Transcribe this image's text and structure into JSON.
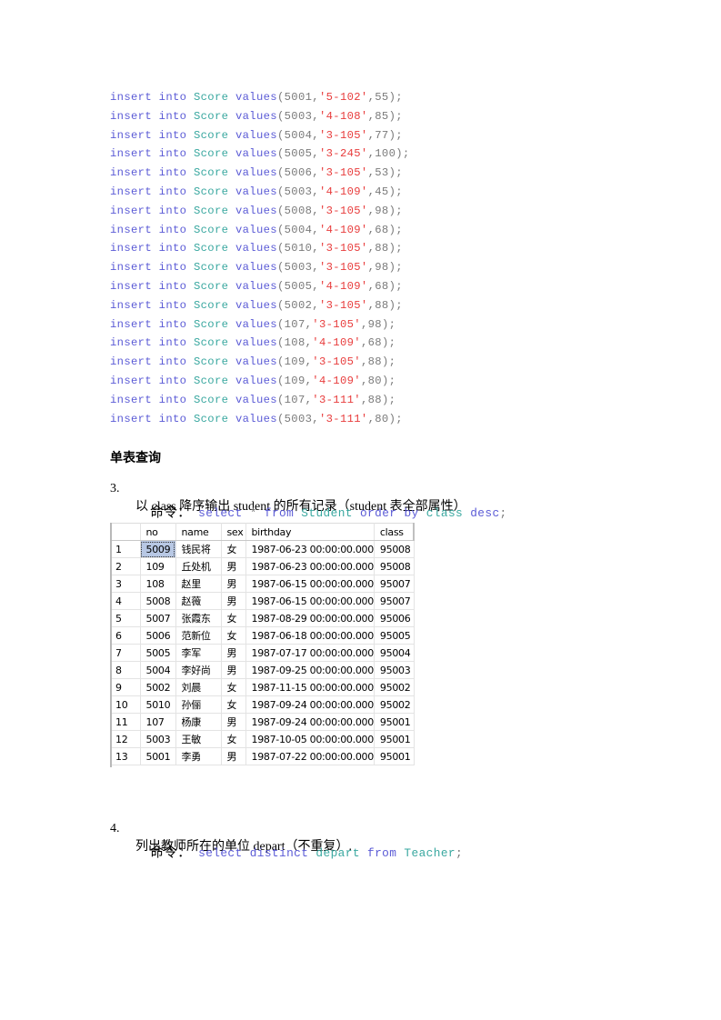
{
  "code_lines": [
    {
      "kw1": "insert",
      "kw2": "into",
      "table": "Score",
      "kw3": "values",
      "id": "5001",
      "course": "'5-102'",
      "score": "55"
    },
    {
      "kw1": "insert",
      "kw2": "into",
      "table": "Score",
      "kw3": "values",
      "id": "5003",
      "course": "'4-108'",
      "score": "85"
    },
    {
      "kw1": "insert",
      "kw2": "into",
      "table": "Score",
      "kw3": "values",
      "id": "5004",
      "course": "'3-105'",
      "score": "77"
    },
    {
      "kw1": "insert",
      "kw2": "into",
      "table": "Score",
      "kw3": "values",
      "id": "5005",
      "course": "'3-245'",
      "score": "100"
    },
    {
      "kw1": "insert",
      "kw2": "into",
      "table": "Score",
      "kw3": "values",
      "id": "5006",
      "course": "'3-105'",
      "score": "53"
    },
    {
      "kw1": "insert",
      "kw2": "into",
      "table": "Score",
      "kw3": "values",
      "id": "5003",
      "course": "'4-109'",
      "score": "45"
    },
    {
      "kw1": "insert",
      "kw2": "into",
      "table": "Score",
      "kw3": "values",
      "id": "5008",
      "course": "'3-105'",
      "score": "98"
    },
    {
      "kw1": "insert",
      "kw2": "into",
      "table": "Score",
      "kw3": "values",
      "id": "5004",
      "course": "'4-109'",
      "score": "68"
    },
    {
      "kw1": "insert",
      "kw2": "into",
      "table": "Score",
      "kw3": "values",
      "id": "5010",
      "course": "'3-105'",
      "score": "88"
    },
    {
      "kw1": "insert",
      "kw2": "into",
      "table": "Score",
      "kw3": "values",
      "id": "5003",
      "course": "'3-105'",
      "score": "98"
    },
    {
      "kw1": "insert",
      "kw2": "into",
      "table": "Score",
      "kw3": "values",
      "id": "5005",
      "course": "'4-109'",
      "score": "68"
    },
    {
      "kw1": "insert",
      "kw2": "into",
      "table": "Score",
      "kw3": "values",
      "id": "5002",
      "course": "'3-105'",
      "score": "88"
    },
    {
      "kw1": "insert",
      "kw2": "into",
      "table": "Score",
      "kw3": "values",
      "id": "107",
      "course": "'3-105'",
      "score": "98"
    },
    {
      "kw1": "insert",
      "kw2": "into",
      "table": "Score",
      "kw3": "values",
      "id": "108",
      "course": "'4-109'",
      "score": "68"
    },
    {
      "kw1": "insert",
      "kw2": "into",
      "table": "Score",
      "kw3": "values",
      "id": "109",
      "course": "'3-105'",
      "score": "88"
    },
    {
      "kw1": "insert",
      "kw2": "into",
      "table": "Score",
      "kw3": "values",
      "id": "109",
      "course": "'4-109'",
      "score": "80"
    },
    {
      "kw1": "insert",
      "kw2": "into",
      "table": "Score",
      "kw3": "values",
      "id": "107",
      "course": "'3-111'",
      "score": "88"
    },
    {
      "kw1": "insert",
      "kw2": "into",
      "table": "Score",
      "kw3": "values",
      "id": "5003",
      "course": "'3-111'",
      "score": "80"
    }
  ],
  "section_title": "单表查询",
  "questions": [
    {
      "num": "3.",
      "text": "以 class 降序输出 student 的所有记录（student 表全部属性）",
      "cmd_label": "命令：",
      "cmd": [
        {
          "t": "select",
          "c": "kw"
        },
        {
          "t": " ",
          "c": "pl"
        },
        {
          "t": "*",
          "c": "pl"
        },
        {
          "t": " ",
          "c": "pl"
        },
        {
          "t": "from",
          "c": "kw"
        },
        {
          "t": " ",
          "c": "pl"
        },
        {
          "t": "Student",
          "c": "tbl"
        },
        {
          "t": " ",
          "c": "pl"
        },
        {
          "t": "order",
          "c": "kw"
        },
        {
          "t": " ",
          "c": "pl"
        },
        {
          "t": "by",
          "c": "kw"
        },
        {
          "t": " ",
          "c": "pl"
        },
        {
          "t": "class",
          "c": "tbl"
        },
        {
          "t": " ",
          "c": "pl"
        },
        {
          "t": "desc",
          "c": "kw"
        },
        {
          "t": ";",
          "c": "pl"
        }
      ]
    },
    {
      "num": "4.",
      "text": "列出教师所在的单位 depart（不重复）.",
      "cmd_label": "命令：",
      "cmd": [
        {
          "t": "select",
          "c": "kw"
        },
        {
          "t": " ",
          "c": "pl"
        },
        {
          "t": "distinct",
          "c": "kw"
        },
        {
          "t": " ",
          "c": "pl"
        },
        {
          "t": "depart",
          "c": "tbl"
        },
        {
          "t": " ",
          "c": "pl"
        },
        {
          "t": "from",
          "c": "kw"
        },
        {
          "t": " ",
          "c": "pl"
        },
        {
          "t": "Teacher",
          "c": "tbl"
        },
        {
          "t": ";",
          "c": "pl"
        }
      ]
    }
  ],
  "result_grid": {
    "columns": [
      "",
      "no",
      "name",
      "sex",
      "birthday",
      "class"
    ],
    "rows": [
      [
        "1",
        "5009",
        "钱民将",
        "女",
        "1987-06-23 00:00:00.000",
        "95008"
      ],
      [
        "2",
        "109",
        "丘处机",
        "男",
        "1987-06-23 00:00:00.000",
        "95008"
      ],
      [
        "3",
        "108",
        "赵里",
        "男",
        "1987-06-15 00:00:00.000",
        "95007"
      ],
      [
        "4",
        "5008",
        "赵薇",
        "男",
        "1987-06-15 00:00:00.000",
        "95007"
      ],
      [
        "5",
        "5007",
        "张霞东",
        "女",
        "1987-08-29 00:00:00.000",
        "95006"
      ],
      [
        "6",
        "5006",
        "范新位",
        "女",
        "1987-06-18 00:00:00.000",
        "95005"
      ],
      [
        "7",
        "5005",
        "李军",
        "男",
        "1987-07-17 00:00:00.000",
        "95004"
      ],
      [
        "8",
        "5004",
        "李好尚",
        "男",
        "1987-09-25 00:00:00.000",
        "95003"
      ],
      [
        "9",
        "5002",
        "刘晨",
        "女",
        "1987-11-15 00:00:00.000",
        "95002"
      ],
      [
        "10",
        "5010",
        "孙俪",
        "女",
        "1987-09-24 00:00:00.000",
        "95002"
      ],
      [
        "11",
        "107",
        "杨康",
        "男",
        "1987-09-24 00:00:00.000",
        "95001"
      ],
      [
        "12",
        "5003",
        "王敏",
        "女",
        "1987-10-05 00:00:00.000",
        "95001"
      ],
      [
        "13",
        "5001",
        "李勇",
        "男",
        "1987-07-22 00:00:00.000",
        "95001"
      ]
    ],
    "selected_cell": {
      "row": 0,
      "col": 1
    }
  }
}
